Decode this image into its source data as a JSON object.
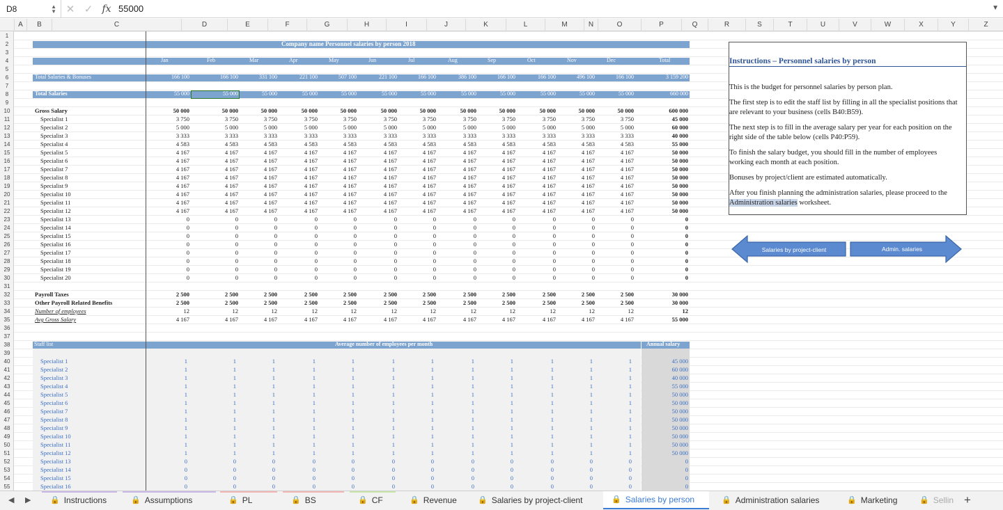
{
  "formula_bar": {
    "cell_ref": "D8",
    "cancel": "✕",
    "confirm": "✓",
    "fx": "fx",
    "value": "55000"
  },
  "columns": [
    "A",
    "B",
    "C",
    "D",
    "E",
    "F",
    "G",
    "H",
    "I",
    "J",
    "K",
    "L",
    "M",
    "N",
    "O",
    "P",
    "Q",
    "R",
    "S",
    "T",
    "U",
    "V",
    "W",
    "X",
    "Y",
    "Z"
  ],
  "row_numbers": [
    "1",
    "2",
    "3",
    "4",
    "5",
    "6",
    "7",
    "8",
    "9",
    "10",
    "11",
    "12",
    "13",
    "14",
    "15",
    "16",
    "17",
    "18",
    "19",
    "20",
    "21",
    "22",
    "23",
    "24",
    "25",
    "26",
    "27",
    "28",
    "29",
    "30",
    "31",
    "32",
    "33",
    "34",
    "35",
    "36",
    "37",
    "38",
    "39",
    "40",
    "41",
    "42",
    "43",
    "44",
    "45",
    "46",
    "47",
    "48",
    "49",
    "50",
    "51",
    "52",
    "53",
    "54",
    "55"
  ],
  "sheet": {
    "title": "Company name Personnel salaries by person 2018",
    "months": [
      "Jan",
      "Feb",
      "Mar",
      "Apr",
      "May",
      "Jun",
      "Jul",
      "Aug",
      "Sep",
      "Oct",
      "Nov",
      "Dec",
      "Total"
    ],
    "total_salaries_bonuses": {
      "label": "Total Salaries & Bonuses",
      "values": [
        "166 100",
        "166 100",
        "331 100",
        "221 100",
        "507 100",
        "221 100",
        "166 100",
        "386 100",
        "166 100",
        "166 100",
        "496 100",
        "166 100",
        "3 159 200"
      ]
    },
    "total_salaries": {
      "label": "Total Salaries",
      "values": [
        "55 000",
        "55 000",
        "55 000",
        "55 000",
        "55 000",
        "55 000",
        "55 000",
        "55 000",
        "55 000",
        "55 000",
        "55 000",
        "55 000",
        "660 000"
      ]
    },
    "gross_salary": {
      "label": "Gross Salary",
      "values": [
        "50 000",
        "50 000",
        "50 000",
        "50 000",
        "50 000",
        "50 000",
        "50 000",
        "50 000",
        "50 000",
        "50 000",
        "50 000",
        "50 000",
        "600 000"
      ]
    },
    "specialists": [
      {
        "label": "Specialist 1",
        "m": "3 750",
        "t": "45 000"
      },
      {
        "label": "Specialist 2",
        "m": "5 000",
        "t": "60 000"
      },
      {
        "label": "Specialist 3",
        "m": "3 333",
        "t": "40 000"
      },
      {
        "label": "Specialist 4",
        "m": "4 583",
        "t": "55 000"
      },
      {
        "label": "Specialist 5",
        "m": "4 167",
        "t": "50 000"
      },
      {
        "label": "Specialist 6",
        "m": "4 167",
        "t": "50 000"
      },
      {
        "label": "Specialist 7",
        "m": "4 167",
        "t": "50 000"
      },
      {
        "label": "Specialist 8",
        "m": "4 167",
        "t": "50 000"
      },
      {
        "label": "Specialist 9",
        "m": "4 167",
        "t": "50 000"
      },
      {
        "label": "Specialist 10",
        "m": "4 167",
        "t": "50 000"
      },
      {
        "label": "Specialist 11",
        "m": "4 167",
        "t": "50 000"
      },
      {
        "label": "Specialist 12",
        "m": "4 167",
        "t": "50 000"
      },
      {
        "label": "Specialist 13",
        "m": "0",
        "t": "0"
      },
      {
        "label": "Specialist 14",
        "m": "0",
        "t": "0"
      },
      {
        "label": "Specialist 15",
        "m": "0",
        "t": "0"
      },
      {
        "label": "Specialist 16",
        "m": "0",
        "t": "0"
      },
      {
        "label": "Specialist 17",
        "m": "0",
        "t": "0"
      },
      {
        "label": "Specialist 18",
        "m": "0",
        "t": "0"
      },
      {
        "label": "Specialist 19",
        "m": "0",
        "t": "0"
      },
      {
        "label": "Specialist 20",
        "m": "0",
        "t": "0"
      }
    ],
    "payroll_taxes": {
      "label": "Payroll Taxes",
      "m": "2 500",
      "t": "30 000"
    },
    "other_benefits": {
      "label": "Other Payroll Related Benefits",
      "m": "2 500",
      "t": "30 000"
    },
    "num_employees": {
      "label": "Number of employees",
      "m": "12",
      "t": "12"
    },
    "avg_gross": {
      "label": "Avg Gross Salary",
      "m": "4 167",
      "t": "55 000"
    },
    "staff_list": {
      "label": "Staff list",
      "header": "Average number of employees per month",
      "annual": "Annual salary",
      "rows": [
        {
          "label": "Specialist 1",
          "n": "1",
          "s": "45 000"
        },
        {
          "label": "Specialist 2",
          "n": "1",
          "s": "60 000"
        },
        {
          "label": "Specialist 3",
          "n": "1",
          "s": "40 000"
        },
        {
          "label": "Specialist 4",
          "n": "1",
          "s": "55 000"
        },
        {
          "label": "Specialist 5",
          "n": "1",
          "s": "50 000"
        },
        {
          "label": "Specialist 6",
          "n": "1",
          "s": "50 000"
        },
        {
          "label": "Specialist 7",
          "n": "1",
          "s": "50 000"
        },
        {
          "label": "Specialist 8",
          "n": "1",
          "s": "50 000"
        },
        {
          "label": "Specialist 9",
          "n": "1",
          "s": "50 000"
        },
        {
          "label": "Specialist 10",
          "n": "1",
          "s": "50 000"
        },
        {
          "label": "Specialist 11",
          "n": "1",
          "s": "50 000"
        },
        {
          "label": "Specialist 12",
          "n": "1",
          "s": "50 000"
        },
        {
          "label": "Specialist 13",
          "n": "0",
          "s": "0"
        },
        {
          "label": "Specialist 14",
          "n": "0",
          "s": "0"
        },
        {
          "label": "Specialist 15",
          "n": "0",
          "s": "0"
        },
        {
          "label": "Specialist 16",
          "n": "0",
          "s": "0"
        }
      ]
    }
  },
  "instructions": {
    "title": "Instructions – Personnel salaries by person",
    "p1": "This is the budget for personnel salaries by person plan.",
    "p2": "The first step is to edit the staff list by filling in all the specialist positions that are relevant to your business (cells B40:B59).",
    "p3": "The next step is to fill in the average salary per year for each position on the right side of the table below (cells P40:P59).",
    "p4": "To finish the salary budget, you should fill in the number of employees working each month at each position.",
    "p5": "Bonuses by project/client are estimated automatically.",
    "p6a": "After you finish planning the administration salaries, please proceed to the ",
    "p6link": "Administration salaries",
    "p6b": " worksheet."
  },
  "nav_buttons": {
    "prev": "Salaries by project-client",
    "next": "Admin. salaries"
  },
  "tabs": [
    {
      "label": "Instructions",
      "lock": false,
      "color": "#c9b8e8"
    },
    {
      "label": "Assumptions",
      "lock": true,
      "color": "#c9b8e8"
    },
    {
      "label": "PL",
      "lock": true,
      "color": "#f4b5b5"
    },
    {
      "label": "BS",
      "lock": true,
      "color": "#f4b5b5"
    },
    {
      "label": "CF",
      "lock": true,
      "color": "#c7e5a8"
    },
    {
      "label": "Revenue",
      "lock": true,
      "color": ""
    },
    {
      "label": "Salaries by project-client",
      "lock": true,
      "color": ""
    },
    {
      "label": "Salaries by person",
      "lock": true,
      "color": ""
    },
    {
      "label": "Administration salaries",
      "lock": true,
      "color": ""
    },
    {
      "label": "Marketing",
      "lock": true,
      "color": ""
    },
    {
      "label": "Sellin",
      "lock": true,
      "color": ""
    }
  ],
  "add_sheet": "+"
}
